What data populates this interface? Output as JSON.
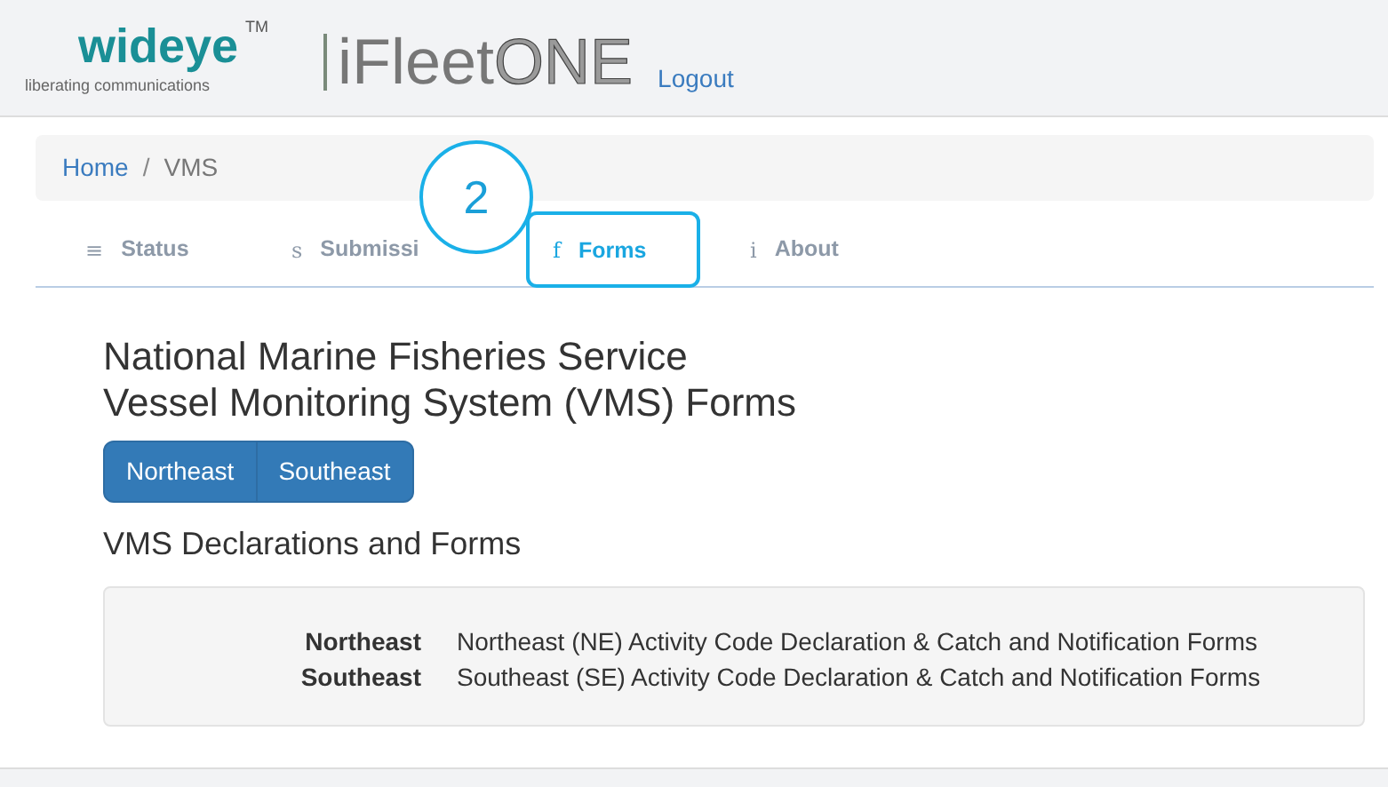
{
  "header": {
    "brand": "wideye",
    "trademark": "TM",
    "tagline": "liberating communications",
    "product_name": "iFleet",
    "product_suffix": "ONE",
    "logout": "Logout"
  },
  "breadcrumb_separator": "/",
  "breadcrumb": [
    {
      "label": "Home",
      "current": false
    },
    {
      "label": "VMS",
      "current": true
    }
  ],
  "tabs": [
    {
      "icon": "≡",
      "label": "Status",
      "selected": false
    },
    {
      "icon": "s",
      "label": "Submissi",
      "selected": false
    },
    {
      "icon": "f",
      "label": "Forms",
      "selected": true
    },
    {
      "icon": "i",
      "label": "About",
      "selected": false
    }
  ],
  "callout": {
    "number": "2"
  },
  "title_lines": [
    "National Marine Fisheries Service",
    "Vessel Monitoring System (VMS) Forms"
  ],
  "region_buttons": [
    "Northeast",
    "Southeast"
  ],
  "section_title": "VMS Declarations and Forms",
  "forms": [
    {
      "region": "Northeast",
      "description": "Northeast (NE) Activity Code Declaration & Catch and Notification Forms"
    },
    {
      "region": "Southeast",
      "description": "Southeast (SE) Activity Code Declaration & Catch and Notification Forms"
    }
  ]
}
